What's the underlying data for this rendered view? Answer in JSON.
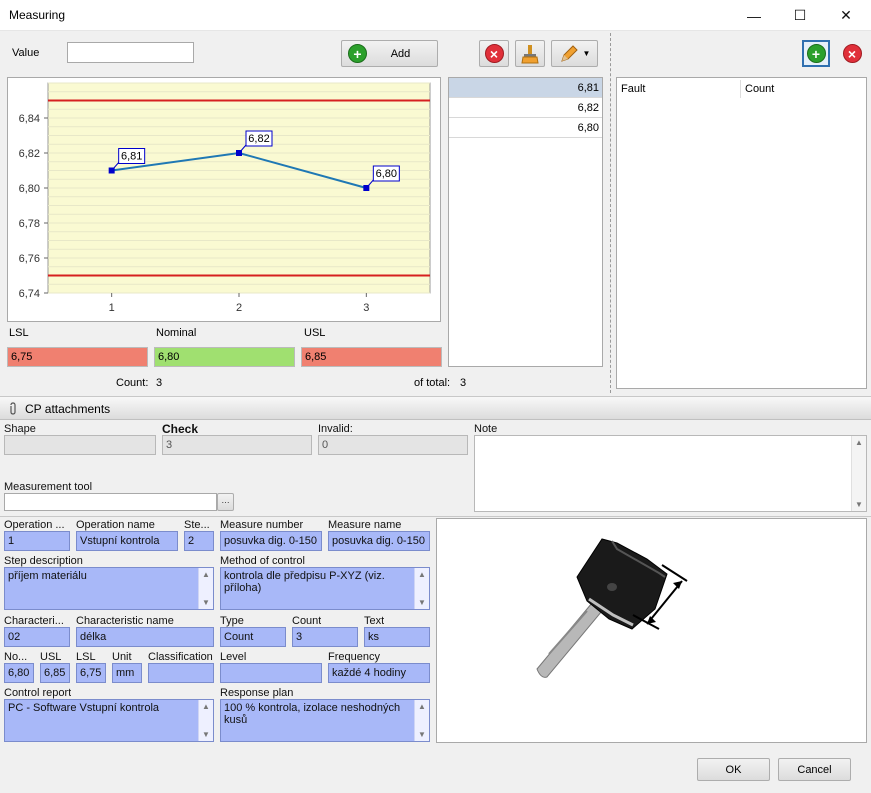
{
  "window": {
    "title": "Measuring",
    "minimize": "—",
    "maximize": "☐",
    "close": "✕"
  },
  "entry": {
    "value_label": "Value",
    "value": "",
    "add_label": "Add"
  },
  "chart_data": {
    "type": "line",
    "categories": [
      "1",
      "2",
      "3"
    ],
    "values": [
      6.81,
      6.82,
      6.8
    ],
    "data_labels": [
      "6,81",
      "6,82",
      "6,80"
    ],
    "y_ticks": [
      "6,84",
      "6,82",
      "6,80",
      "6,78",
      "6,76",
      "6,74"
    ],
    "ylim": [
      6.74,
      6.86
    ],
    "limits": {
      "lsl": 6.75,
      "usl": 6.85
    },
    "grid": true,
    "line_color": "#1f78b4",
    "limit_color": "#d62020",
    "plot_bg": "#fafad2"
  },
  "limits": {
    "lsl_label": "LSL",
    "lsl": "6,75",
    "nominal_label": "Nominal",
    "nominal": "6,80",
    "usl_label": "USL",
    "usl": "6,85"
  },
  "counts": {
    "count_label": "Count:",
    "count": "3",
    "total_label": "of total:",
    "total": "3"
  },
  "values_list": [
    "6,81",
    "6,82",
    "6,80"
  ],
  "faults": {
    "col_fault": "Fault",
    "col_count": "Count"
  },
  "attachments": {
    "label": "CP attachments"
  },
  "check": {
    "shape_label": "Shape",
    "shape": "",
    "check_label": "Check",
    "check": "3",
    "invalid_label": "Invalid:",
    "invalid": "0",
    "note_label": "Note",
    "note": "",
    "tool_label": "Measurement tool",
    "tool": "",
    "tool_btn": "···"
  },
  "details": {
    "op_label": "Operation ...",
    "op": "1",
    "opname_label": "Operation name",
    "opname": "Vstupní kontrola",
    "step_label": "Ste...",
    "step": "2",
    "measnum_label": "Measure number",
    "measnum": "posuvka dig. 0-150",
    "measname_label": "Measure name",
    "measname": "posuvka dig. 0-150",
    "stepdesc_label": "Step description",
    "stepdesc": "příjem materiálu",
    "method_label": "Method of control",
    "method": "kontrola dle předpisu P-XYZ (viz. příloha)",
    "char_label": "Characteri...",
    "char": "02",
    "charname_label": "Characteristic name",
    "charname": "délka",
    "type_label": "Type",
    "type": "Count",
    "count_label": "Count",
    "count": "3",
    "text_label": "Text",
    "text": "ks",
    "no_label": "No...",
    "no": "6,80",
    "usl_label": "USL",
    "usl": "6,85",
    "lsl_label": "LSL",
    "lsl": "6,75",
    "unit_label": "Unit",
    "unit": "mm",
    "class_label": "Classification",
    "class": "",
    "level_label": "Level",
    "level": "",
    "freq_label": "Frequency",
    "freq": "každé 4 hodiny",
    "report_label": "Control report",
    "report": "PC - Software Vstupní kontrola",
    "response_label": "Response plan",
    "response": "100 % kontrola, izolace neshodných kusů"
  },
  "footer": {
    "ok": "OK",
    "cancel": "Cancel"
  }
}
